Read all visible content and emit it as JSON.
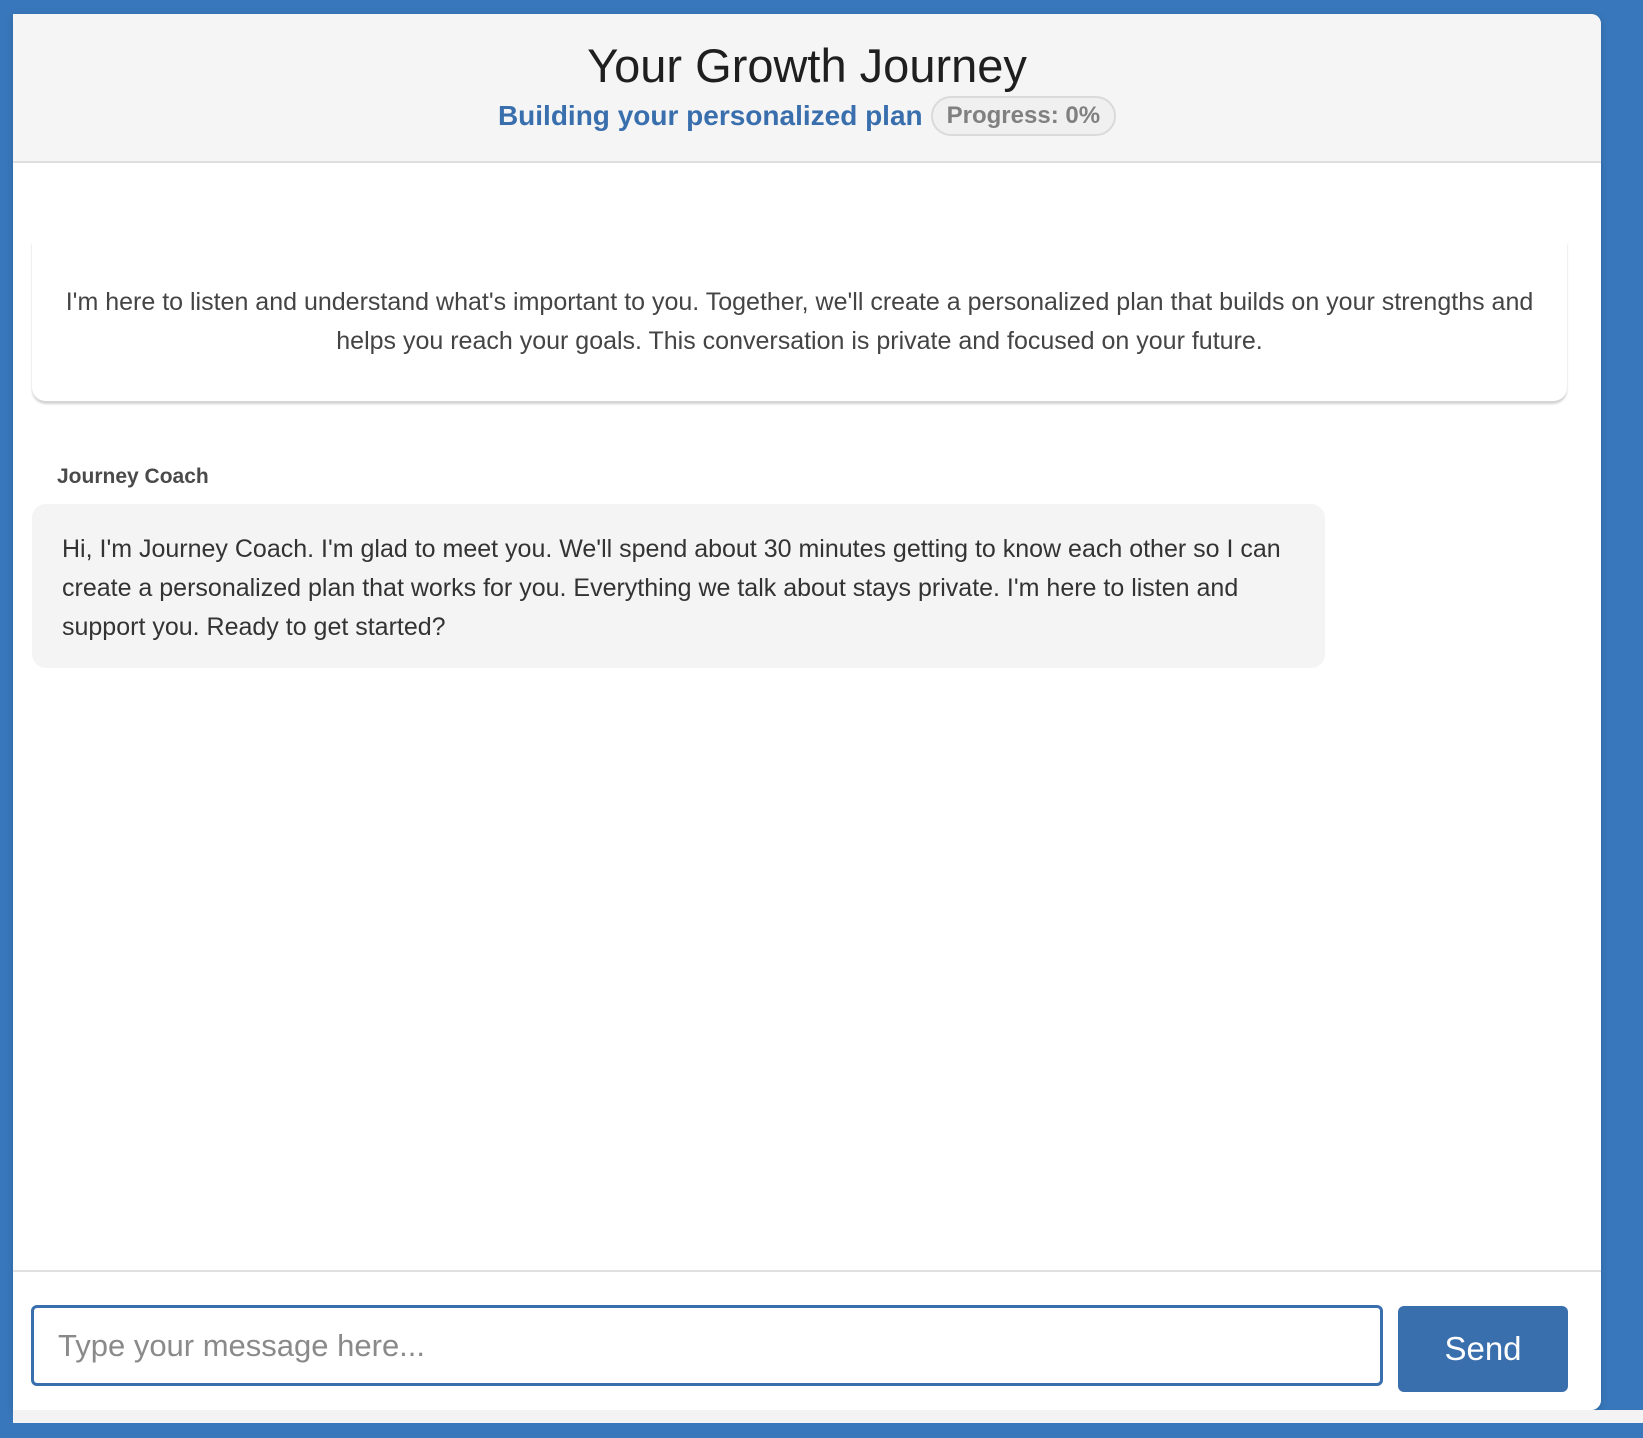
{
  "header": {
    "title": "Your Growth Journey",
    "subtitle": "Building your personalized plan",
    "progress_label": "Progress: 0%"
  },
  "intro": {
    "text": "I'm here to listen and understand what's important to you. Together, we'll create a personalized plan that builds on your strengths and helps you reach your goals. This conversation is private and focused on your future."
  },
  "messages": [
    {
      "sender": "Journey Coach",
      "text": "Hi, I'm Journey Coach. I'm glad to meet you. We'll spend about 30 minutes getting to know each other so I can create a personalized plan that works for you. Everything we talk about stays private. I'm here to listen and support you. Ready to get started?"
    }
  ],
  "composer": {
    "placeholder": "Type your message here...",
    "value": "",
    "send_label": "Send"
  },
  "colors": {
    "accent": "#3a6fae",
    "frame": "#3877bb"
  }
}
